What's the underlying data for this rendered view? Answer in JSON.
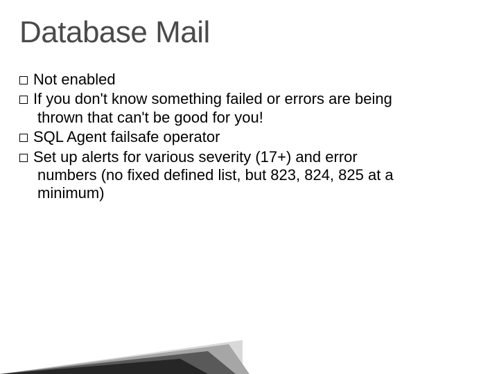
{
  "title": "Database Mail",
  "bullets": [
    "Not enabled",
    "If you don't know something failed or errors are being thrown that can't be good for you!",
    "SQL Agent failsafe operator",
    "Set up alerts for various severity (17+) and error numbers (no fixed defined list, but 823, 824, 825 at a minimum)"
  ]
}
